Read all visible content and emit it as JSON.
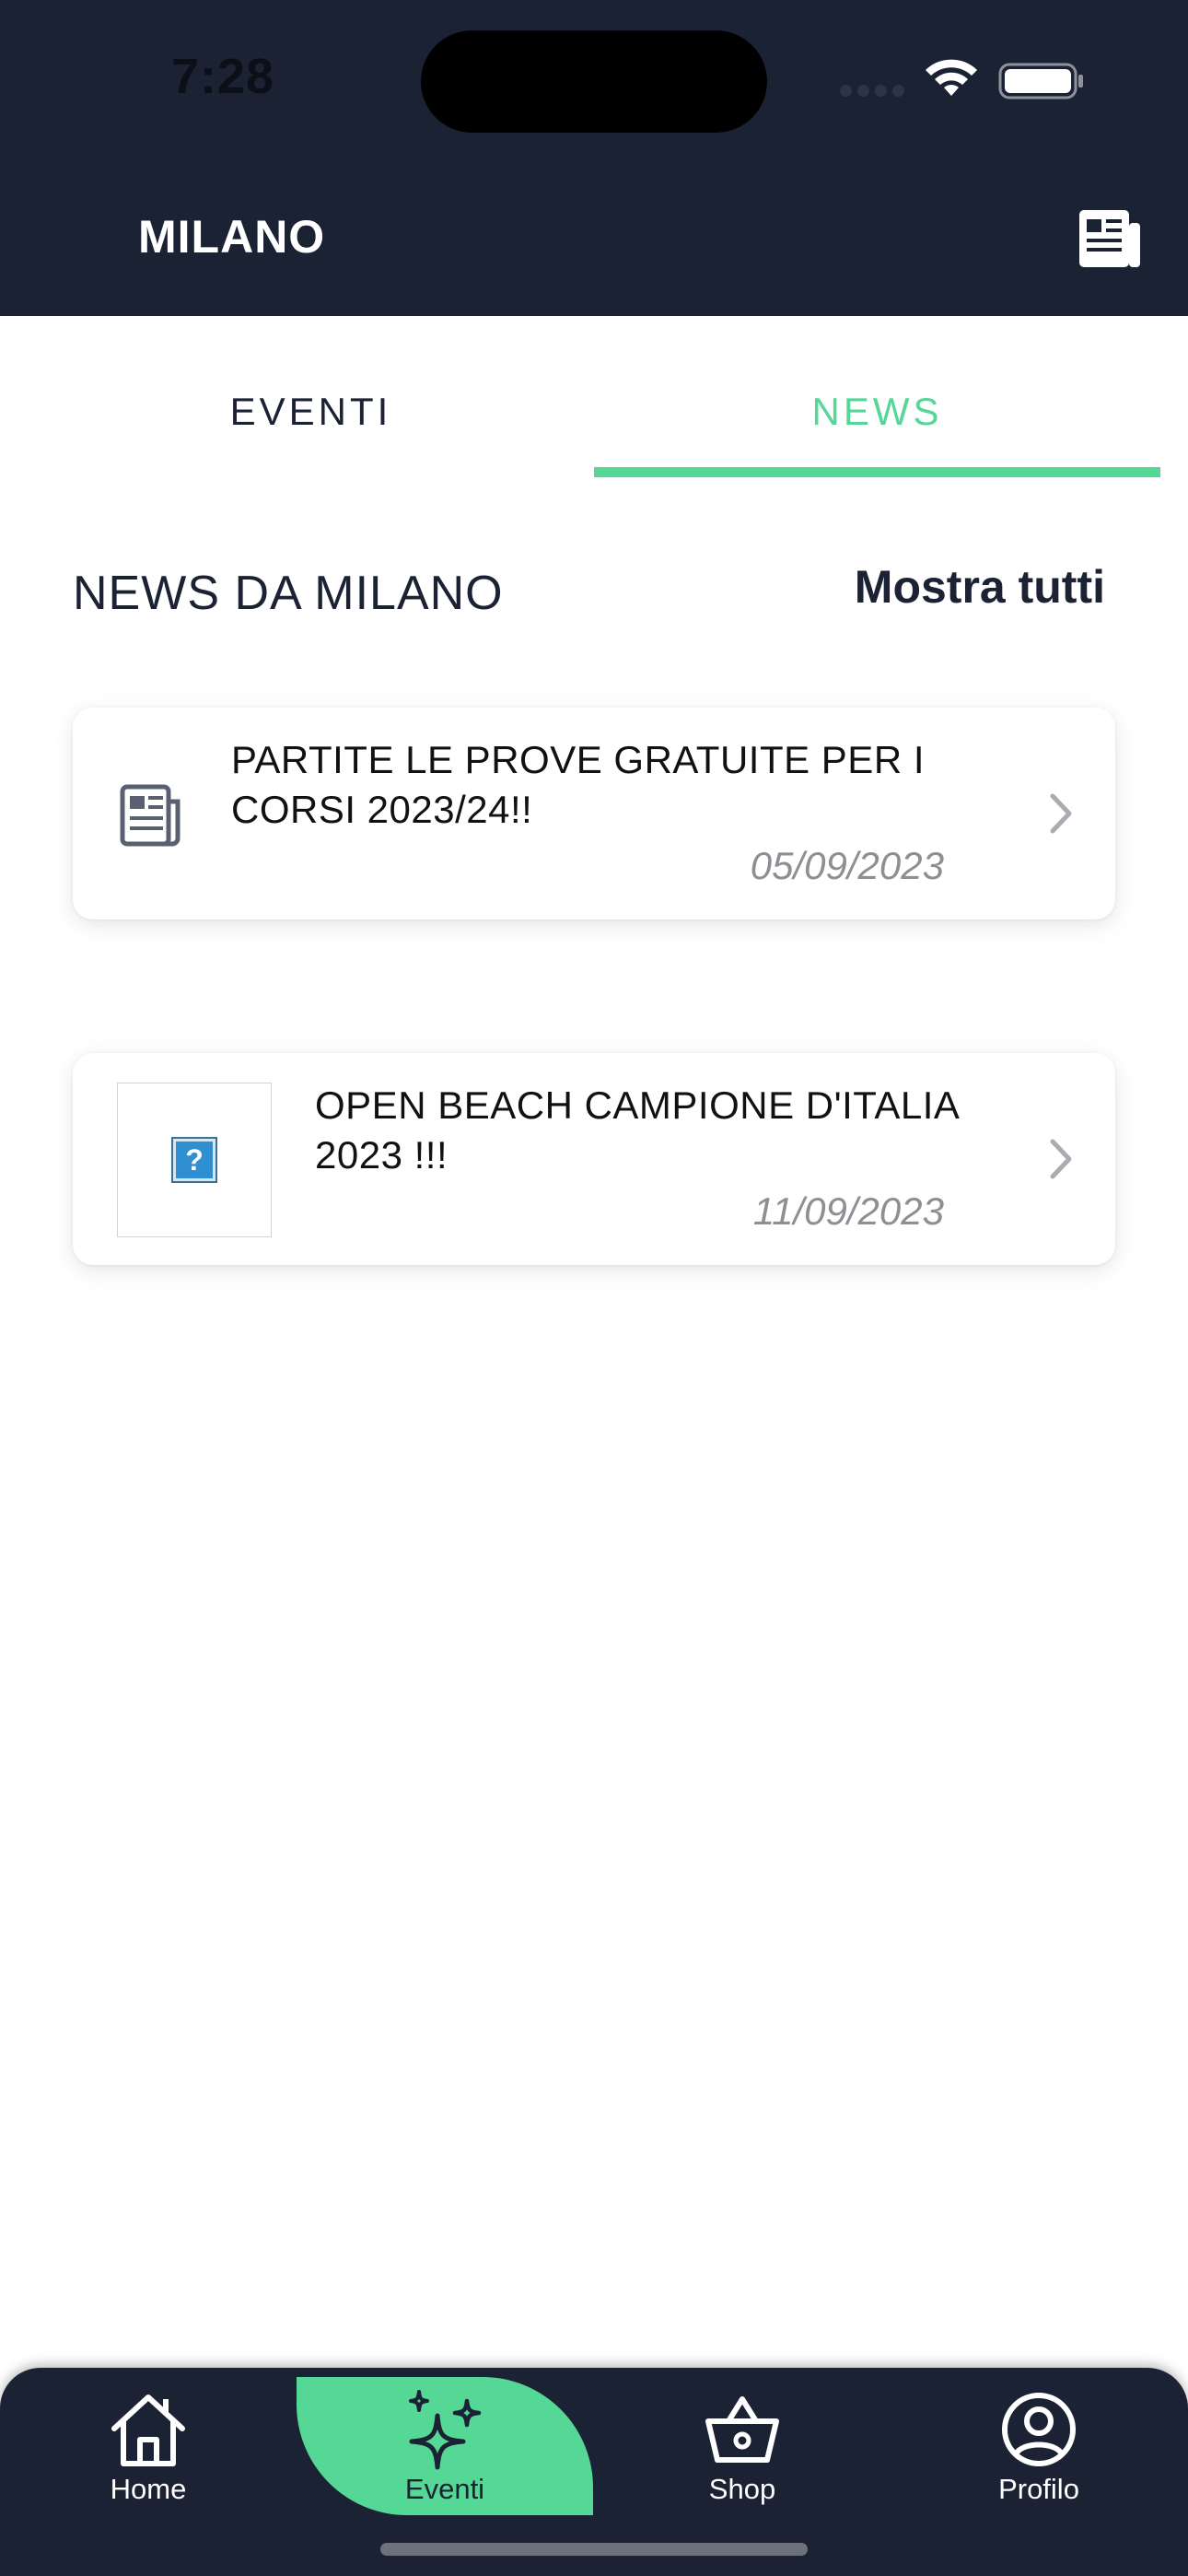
{
  "status_bar": {
    "time": "7:28"
  },
  "header": {
    "title": "MILANO",
    "right_icon": "newspaper-icon"
  },
  "tabs": [
    {
      "label": "EVENTI",
      "active": false
    },
    {
      "label": "NEWS",
      "active": true
    }
  ],
  "section": {
    "title": "NEWS DA MILANO",
    "show_all": "Mostra tutti"
  },
  "news": [
    {
      "title": "PARTITE LE PROVE GRATUITE PER I CORSI 2023/24!!",
      "date": "05/09/2023",
      "icon": "newspaper-icon"
    },
    {
      "title": "OPEN BEACH CAMPIONE D'ITALIA 2023 !!!",
      "date": "11/09/2023",
      "icon": "broken-image-icon"
    }
  ],
  "bottom_nav": [
    {
      "label": "Home",
      "icon": "home-icon"
    },
    {
      "label": "Eventi",
      "icon": "sparkles-icon",
      "active": true
    },
    {
      "label": "Shop",
      "icon": "basket-icon"
    },
    {
      "label": "Profilo",
      "icon": "user-circle-icon"
    }
  ],
  "colors": {
    "primary_dark": "#1b2234",
    "accent": "#55d796",
    "date_gray": "#8d8f93"
  }
}
